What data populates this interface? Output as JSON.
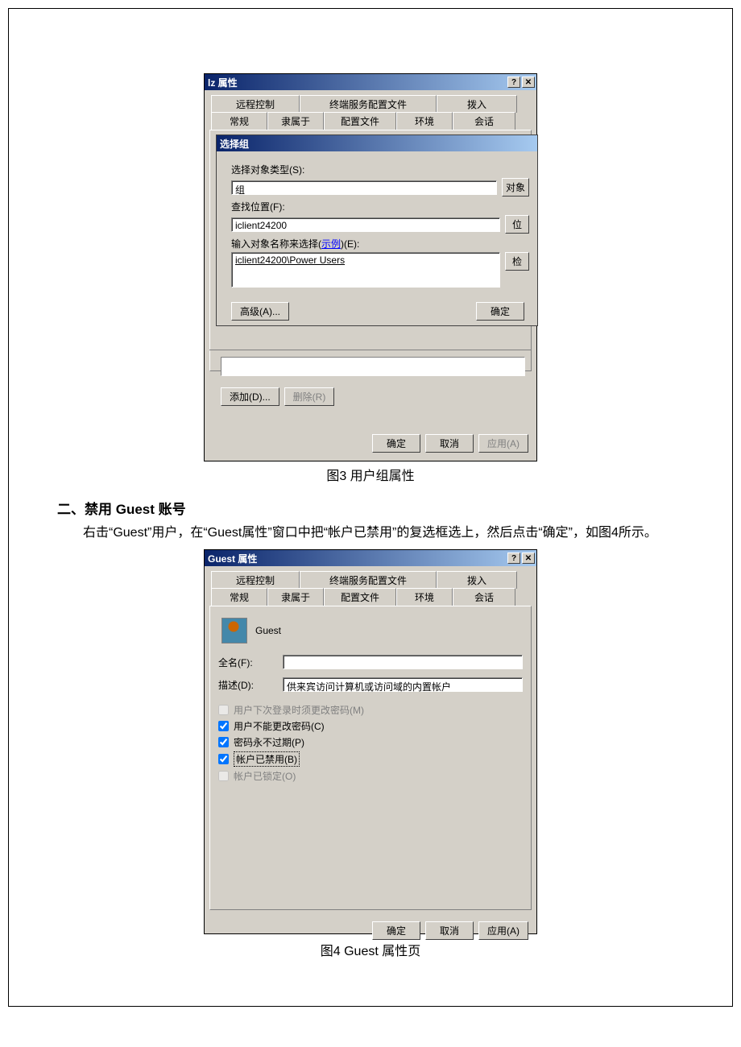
{
  "fig3": {
    "title": "lz 属性",
    "tabs_back": [
      "远程控制",
      "终端服务配置文件",
      "拨入"
    ],
    "tabs_front": [
      "常规",
      "隶属于",
      "配置文件",
      "环境",
      "会话"
    ],
    "sub": {
      "title": "选择组",
      "lbl_type": "选择对象类型(S):",
      "type_value": "组",
      "btn_obj": "对象",
      "lbl_loc": "查找位置(F):",
      "loc_value": "iclient24200",
      "btn_loc": "位",
      "lbl_names_pre": "输入对象名称来选择(",
      "lbl_names_link": "示例",
      "lbl_names_post": ")(E):",
      "names_value": "iclient24200\\Power Users",
      "btn_check": "检",
      "btn_adv": "高级(A)...",
      "btn_ok": "确定"
    },
    "btn_add": "添加(D)...",
    "btn_del": "删除(R)",
    "btn_ok": "确定",
    "btn_cancel": "取消",
    "btn_apply": "应用(A)",
    "caption": "图3 用户组属性"
  },
  "section2": {
    "heading": "二、禁用 Guest 账号",
    "para": "　　右击“Guest”用户，在“Guest属性”窗口中把“帐户已禁用”的复选框选上，然后点击“确定”，如图4所示。"
  },
  "fig4": {
    "title": "Guest 属性",
    "tabs_back": [
      "远程控制",
      "终端服务配置文件",
      "拨入"
    ],
    "tabs_front": [
      "常规",
      "隶属于",
      "配置文件",
      "环境",
      "会话"
    ],
    "user": "Guest",
    "lbl_full": "全名(F):",
    "full_value": "",
    "lbl_desc": "描述(D):",
    "desc_value": "供来宾访问计算机或访问域的内置帐户",
    "chk1": "用户下次登录时须更改密码(M)",
    "chk2": "用户不能更改密码(C)",
    "chk3": "密码永不过期(P)",
    "chk4": "帐户已禁用(B)",
    "chk5": "帐户已锁定(O)",
    "btn_ok": "确定",
    "btn_cancel": "取消",
    "btn_apply": "应用(A)",
    "caption": "图4  Guest 属性页"
  },
  "icons": {
    "help": "?",
    "close": "✕"
  }
}
